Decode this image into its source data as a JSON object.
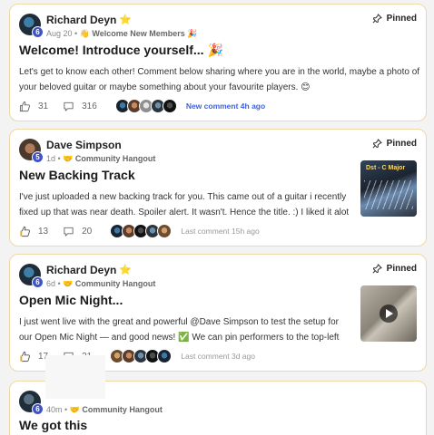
{
  "colors": {
    "card_border": "#ecd9a6",
    "accent_blue": "#3f62d8",
    "level_badge": "#3f53c9",
    "star": "#f2b90c"
  },
  "posts": [
    {
      "author": "Richard Deyn",
      "author_star": "⭐",
      "level": "6",
      "date": "Aug 20",
      "category": "👋 Welcome New Members 🎉",
      "pinned_label": "Pinned",
      "title": "Welcome! Introduce yourself... 🎉",
      "excerpt": "Let's get to know each other! Comment below sharing where you are in the world, maybe a photo of your beloved guitar or maybe something about your favourite players. 😊",
      "likes": "31",
      "comments": "316",
      "activity": "New comment 4h ago"
    },
    {
      "author": "Dave Simpson",
      "level": "5",
      "date": "1d",
      "category": "🤝 Community Hangout",
      "pinned_label": "Pinned",
      "title": "New Backing Track",
      "excerpt": "I've just uploaded a new backing track for you. This came out of a guitar i recently fixed up that was near death. Spoiler alert. It wasn't. Hence the title. :) I liked it alot though",
      "thumbnail_text": "Dst - C Major",
      "likes": "13",
      "comments": "20",
      "activity": "Last comment 15h ago"
    },
    {
      "author": "Richard Deyn",
      "author_star": "⭐",
      "level": "6",
      "date": "6d",
      "category": "🤝 Community Hangout",
      "pinned_label": "Pinned",
      "title": "Open Mic Night...",
      "excerpt": "I just went live with the great and powerful @Dave Simpson to test the setup for our Open Mic Night — and good news! ✅ We can pin performers to the top-left corner of",
      "likes": "17",
      "comments": "21",
      "activity": "Last comment 3d ago"
    },
    {
      "level": "6",
      "date": "40m",
      "category": "🤝 Community Hangout",
      "title": "We got this"
    }
  ]
}
